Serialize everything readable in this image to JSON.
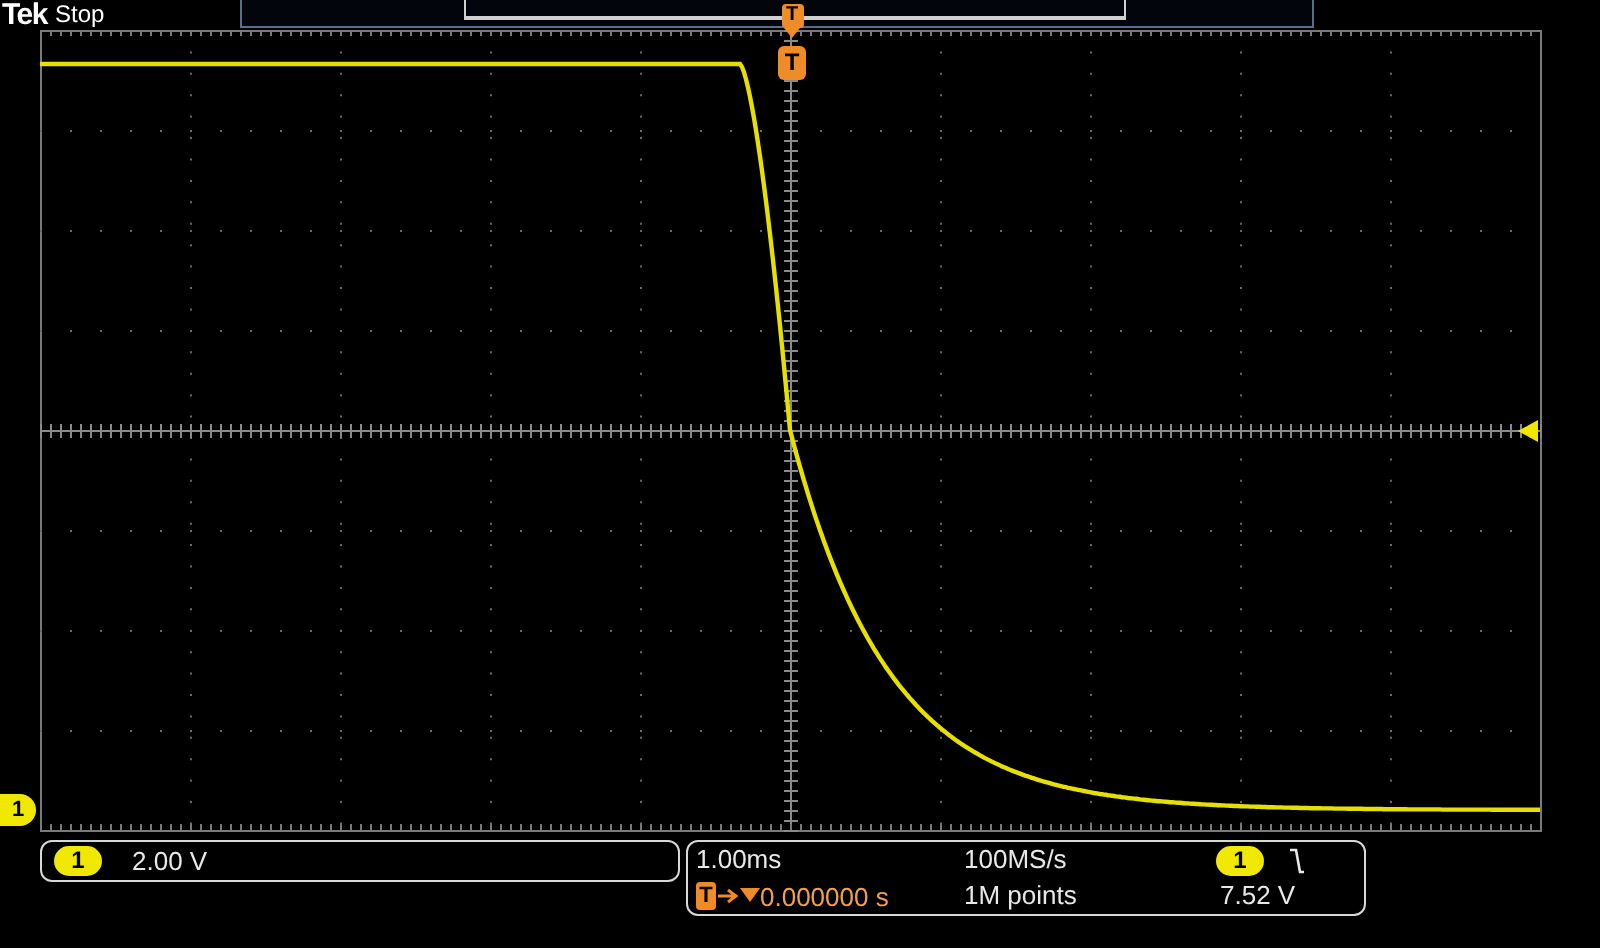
{
  "header": {
    "brand": "Tek",
    "acquisition_state": "Stop"
  },
  "trigger_position_marker": {
    "label": "T"
  },
  "record_trigger_marker": {
    "label": "T"
  },
  "ground_marker": {
    "label": "1",
    "color": "#f0e800"
  },
  "trigger_level_marker": {
    "color": "#f0e800"
  },
  "channel": {
    "label": "1",
    "scale": "2.00 V",
    "color": "#f0e800"
  },
  "horizontal": {
    "scale": "1.00ms",
    "sample_rate": "100MS/s",
    "record_length": "1M points",
    "trigger_icon_label": "T",
    "delay": "0.000000 s"
  },
  "trigger": {
    "source": "1",
    "falling_edge": true,
    "level": "7.52 V",
    "color": "#f0e800"
  }
}
